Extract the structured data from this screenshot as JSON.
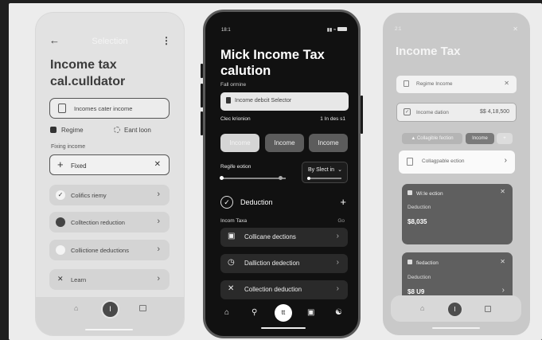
{
  "left": {
    "header_title": "Selection",
    "back_icon": "arrow-left-icon",
    "title": "Income tax cal.culldator",
    "income_field_placeholder": "Incomes cater income",
    "regime_label": "Regime",
    "regime_option": "Eant loon",
    "fixing_label": "Fixing income",
    "fixed_field_value": "Fixed",
    "list": [
      {
        "label": "Colifics riemy",
        "lead": "check"
      },
      {
        "label": "Colltection reduction",
        "lead": "dark-circle"
      },
      {
        "label": "Collictione deductions",
        "lead": "white-circle"
      },
      {
        "label": "Learn",
        "lead": "x"
      }
    ],
    "fab_label": "I"
  },
  "center": {
    "time": "18:1",
    "title": "Mick Income Tax calution",
    "sub_label": "Fall ormine",
    "selector_text": "Income debcit Selector",
    "check_label": "Clec krionion",
    "check_value": "1 In des s1",
    "pills": [
      "Income",
      "Income",
      "Income"
    ],
    "slider_label": "Regife eotion",
    "dropdown_label": "By Slect in",
    "deduction_title": "Deduction",
    "section_label": "Incom Taxa",
    "section_tag": "Go",
    "rows": [
      {
        "label": "Collicane dections",
        "icon": "doc-icon"
      },
      {
        "label": "Dalliction dedection",
        "icon": "clock-icon"
      },
      {
        "label": "Collection deduction",
        "icon": "close-icon"
      }
    ],
    "fab_label": "tt"
  },
  "right": {
    "time": "2:1",
    "title": "Income Tax",
    "card1": "Regime Income",
    "card2_label": "Income dation",
    "card2_value": "$$ 4,18,500",
    "chip1": "Collagible fection",
    "chip2": "Income",
    "collapsible": "Collagpable ection",
    "dark1": {
      "title": "Wi:le ection",
      "label": "Deduction",
      "value": "$8,035"
    },
    "dark2": {
      "title": "fiedaction",
      "label": "Deduction",
      "value": "$8 U9"
    },
    "fab_label": "I"
  }
}
